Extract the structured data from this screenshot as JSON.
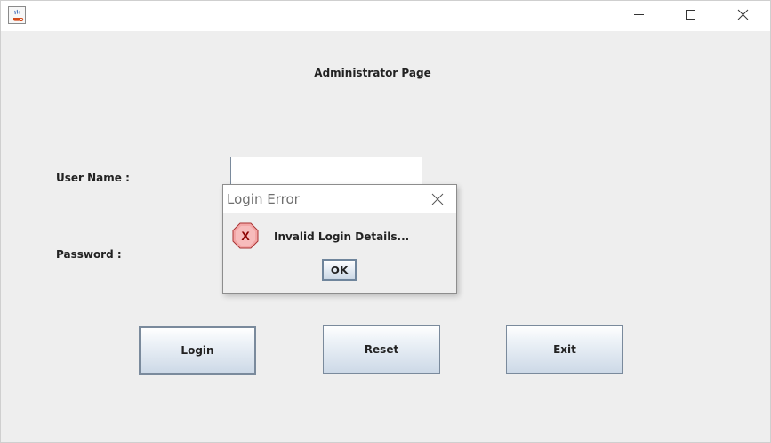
{
  "window": {
    "title_icon": "java-coffee-cup-icon",
    "controls": {
      "minimize_icon": "minimize-icon",
      "maximize_icon": "maximize-icon",
      "close_icon": "close-icon"
    }
  },
  "form": {
    "title": "Administrator Page",
    "username_label": "User Name :",
    "username_value": "",
    "password_label": "Password :",
    "buttons": {
      "login": "Login",
      "reset": "Reset",
      "exit": "Exit"
    }
  },
  "dialog": {
    "title": "Login Error",
    "message": "Invalid Login Details...",
    "ok_label": "OK",
    "icon": "error-x-icon"
  },
  "colors": {
    "window_bg": "#eeeeee",
    "button_border": "#7a8a9c",
    "error_icon_fill": "#f3a6a6",
    "error_icon_mark": "#8b0000"
  }
}
